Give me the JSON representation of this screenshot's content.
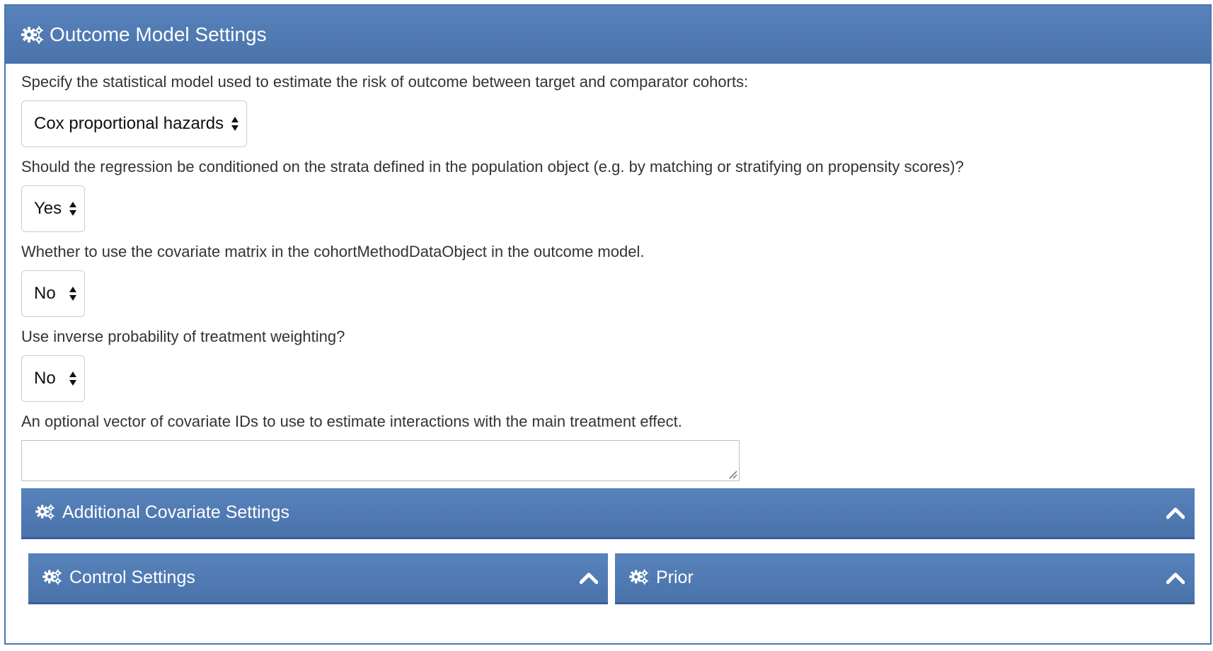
{
  "panel": {
    "title": "Outcome Model Settings",
    "icon": "cogs-icon"
  },
  "fields": {
    "model": {
      "label": "Specify the statistical model used to estimate the risk of outcome between target and comparator cohorts:",
      "value": "Cox proportional hazards"
    },
    "stratified": {
      "label": "Should the regression be conditioned on the strata defined in the population object (e.g. by matching or stratifying on propensity scores)?",
      "value": "Yes"
    },
    "covariate_matrix": {
      "label": "Whether to use the covariate matrix in the cohortMethodDataObject in the outcome model.",
      "value": "No"
    },
    "iptw": {
      "label": "Use inverse probability of treatment weighting?",
      "value": "No"
    },
    "interaction_covariates": {
      "label": "An optional vector of covariate IDs to use to estimate interactions with the main treatment effect.",
      "value": ""
    }
  },
  "sections": {
    "additional_covariate": {
      "title": "Additional Covariate Settings"
    },
    "control": {
      "title": "Control Settings"
    },
    "prior": {
      "title": "Prior"
    }
  },
  "colors": {
    "header": "#4f78b1",
    "border": "#4a76b0"
  }
}
